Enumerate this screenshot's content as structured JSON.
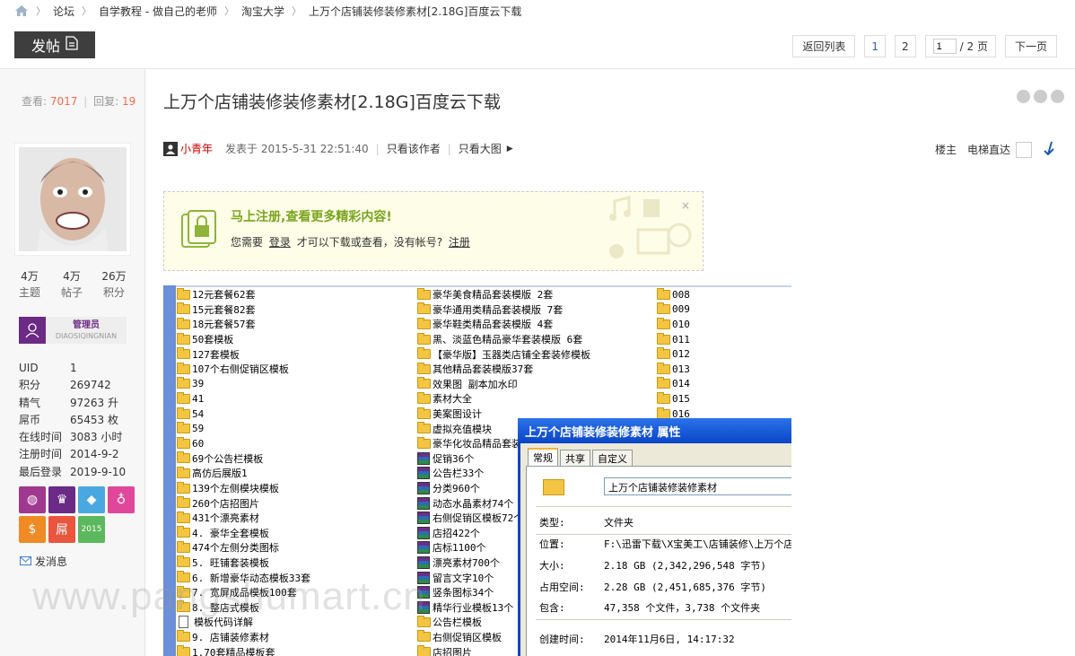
{
  "breadcrumb": [
    "论坛",
    "自学教程 - 做自己的老师",
    "淘宝大学",
    "上万个店铺装修装修素材[2.18G]百度云下载"
  ],
  "toolbar": {
    "post_label": "发帖",
    "back_label": "返回列表",
    "page1": "1",
    "page2": "2",
    "page_input": "1",
    "page_total": "/ 2 页",
    "next_label": "下一页"
  },
  "sidebar": {
    "views_label": "查看:",
    "views": "7017",
    "sep": "|",
    "replies_label": "回复:",
    "replies": "19",
    "stats": [
      {
        "value": "4万",
        "label": "主题"
      },
      {
        "value": "4万",
        "label": "帖子"
      },
      {
        "value": "26万",
        "label": "积分"
      }
    ],
    "role": "管理员",
    "role_sub": "DIAOSIQINGNIAN",
    "info": [
      {
        "k": "UID",
        "v": "1"
      },
      {
        "k": "积分",
        "v": "269742"
      },
      {
        "k": "精气",
        "v": "97263 升"
      },
      {
        "k": "屌币",
        "v": "65453 枚"
      },
      {
        "k": "在线时间",
        "v": "3083 小时"
      },
      {
        "k": "注册时间",
        "v": "2014-9-2"
      },
      {
        "k": "最后登录",
        "v": "2019-9-10"
      }
    ],
    "badges": [
      {
        "glyph": "◍",
        "color": "#a0388f"
      },
      {
        "glyph": "♛",
        "color": "#6b2a85"
      },
      {
        "glyph": "◆",
        "color": "#4aa8e0"
      },
      {
        "glyph": "♁",
        "color": "#e0479a"
      },
      {
        "glyph": "$",
        "color": "#f08a24"
      },
      {
        "glyph": "屌",
        "color": "#e9553d"
      },
      {
        "glyph": "2015",
        "color": "#5cb85c"
      }
    ],
    "message_label": "发消息"
  },
  "post": {
    "title": "上万个店铺装修装修素材[2.18G]百度云下载",
    "author": "小青年",
    "posted": "发表于 2015-5-31 22:51:40",
    "only_author": "只看该作者",
    "only_big": "只看大图",
    "floor_label": "楼主",
    "elevator_label": "电梯直达"
  },
  "notice": {
    "title": "马上注册,查看更多精彩内容!",
    "text_pre": "您需要",
    "login": "登录",
    "text_mid": "才可以下载或查看，没有帐号?",
    "register": "注册",
    "close": "×"
  },
  "explorer": {
    "col1": [
      {
        "t": "folder",
        "n": "12元套餐62套"
      },
      {
        "t": "folder",
        "n": "15元套餐82套"
      },
      {
        "t": "folder",
        "n": "18元套餐57套"
      },
      {
        "t": "folder",
        "n": "50套模板"
      },
      {
        "t": "folder",
        "n": "127套模板"
      },
      {
        "t": "folder",
        "n": "107个右侧促销区模板"
      },
      {
        "t": "folder",
        "n": "39"
      },
      {
        "t": "folder",
        "n": "41"
      },
      {
        "t": "folder",
        "n": "54"
      },
      {
        "t": "folder",
        "n": "59"
      },
      {
        "t": "folder",
        "n": "60"
      },
      {
        "t": "folder",
        "n": "69个公告栏模板"
      },
      {
        "t": "folder",
        "n": "高仿后展版1"
      },
      {
        "t": "folder",
        "n": "139个左侧模块模板"
      },
      {
        "t": "folder",
        "n": "260个店招图片"
      },
      {
        "t": "folder",
        "n": "431个漂亮素材"
      },
      {
        "t": "folder",
        "n": "4. 豪华全套模板"
      },
      {
        "t": "folder",
        "n": "474个左侧分类图标"
      },
      {
        "t": "folder",
        "n": "5. 旺铺套装模板"
      },
      {
        "t": "folder",
        "n": "6. 新增豪华动态模板33套"
      },
      {
        "t": "folder",
        "n": "7. 宽屏成品模板100套"
      },
      {
        "t": "folder",
        "n": "8. 整店式模板"
      },
      {
        "t": "doc",
        "n": "模板代码详解"
      },
      {
        "t": "folder",
        "n": "9. 店铺装修素材"
      },
      {
        "t": "folder",
        "n": "1.70套精品模板套"
      }
    ],
    "col2": [
      {
        "t": "folder",
        "n": "豪华美食精品套装模版 2套"
      },
      {
        "t": "folder",
        "n": "豪华通用类精品套装模版 7套"
      },
      {
        "t": "folder",
        "n": "豪华鞋类精品套装模版 4套"
      },
      {
        "t": "folder",
        "n": "黑、淡蓝色精品豪华套装模版 6套"
      },
      {
        "t": "folder",
        "n": "【豪华版】玉器类店铺全套装修模板"
      },
      {
        "t": "folder",
        "n": "其他精品套装模版37套"
      },
      {
        "t": "folder",
        "n": "效果图 副本加水印"
      },
      {
        "t": "folder",
        "n": "素材大全"
      },
      {
        "t": "folder",
        "n": "美案图设计"
      },
      {
        "t": "folder",
        "n": "虚拟充值模块"
      },
      {
        "t": "folder",
        "n": "豪华化妆品精品套装"
      },
      {
        "t": "rar",
        "n": "促销36个"
      },
      {
        "t": "rar",
        "n": "公告栏33个"
      },
      {
        "t": "rar",
        "n": "分类960个"
      },
      {
        "t": "rar",
        "n": "动态水晶素材74个"
      },
      {
        "t": "rar",
        "n": "右侧促销区模板72个"
      },
      {
        "t": "rar",
        "n": "店招422个"
      },
      {
        "t": "rar",
        "n": "店标1100个"
      },
      {
        "t": "rar",
        "n": "漂亮素材700个"
      },
      {
        "t": "rar",
        "n": "留言文字10个"
      },
      {
        "t": "rar",
        "n": "竖条图标34个"
      },
      {
        "t": "rar",
        "n": "精华行业模板13个"
      },
      {
        "t": "folder",
        "n": "公告栏模板"
      },
      {
        "t": "folder",
        "n": "右侧促销区模板"
      },
      {
        "t": "folder",
        "n": "店招图片"
      }
    ],
    "col3": [
      "008",
      "009",
      "010",
      "011",
      "012",
      "013",
      "014",
      "015",
      "016"
    ]
  },
  "dialog": {
    "title": "上万个店铺装修装修素材 属性",
    "tabs": [
      "常规",
      "共享",
      "自定义"
    ],
    "name": "上万个店铺装修装修素材",
    "rows": [
      {
        "k": "类型:",
        "v": "文件夹"
      },
      {
        "k": "位置:",
        "v": "F:\\迅雷下载\\X宝美工\\店铺装修\\上万个店"
      },
      {
        "k": "大小:",
        "v": "2.18 GB (2,342,296,548 字节)"
      },
      {
        "k": "占用空间:",
        "v": "2.28 GB (2,451,685,376 字节)"
      },
      {
        "k": "包含:",
        "v": "47,358 个文件，3,738 个文件夹"
      },
      {
        "k": "创建时间:",
        "v": "2014年11月6日, 14:17:32"
      }
    ]
  },
  "watermark": "www.pangshumart.cn"
}
